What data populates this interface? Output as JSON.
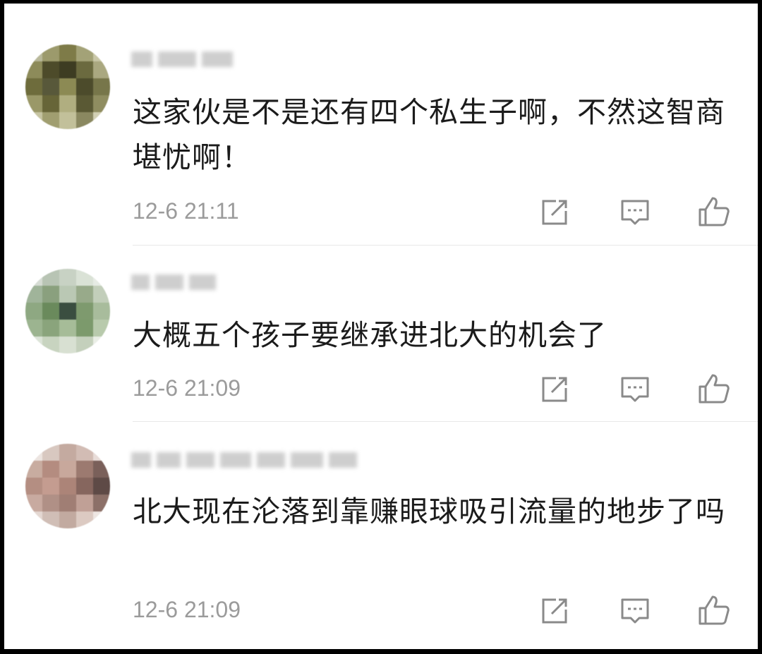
{
  "comments": [
    {
      "username": "",
      "text": "这家伙是不是还有四个私生子啊，不然这智商堪忧啊！",
      "time": "12-6 21:11"
    },
    {
      "username": "",
      "text": "大概五个孩子要继承进北大的机会了",
      "time": "12-6 21:09"
    },
    {
      "username": "",
      "text": "北大现在沦落到靠赚眼球吸引流量的地步了吗",
      "time": "12-6 21:09"
    }
  ],
  "icons": {
    "share": "share-icon",
    "reply": "comment-icon",
    "like": "thumbs-up-icon"
  },
  "colors": {
    "text": "#1b1b1b",
    "meta": "#9b9b9b",
    "icon": "#8a8a8a",
    "divider": "#e8e8e8"
  }
}
